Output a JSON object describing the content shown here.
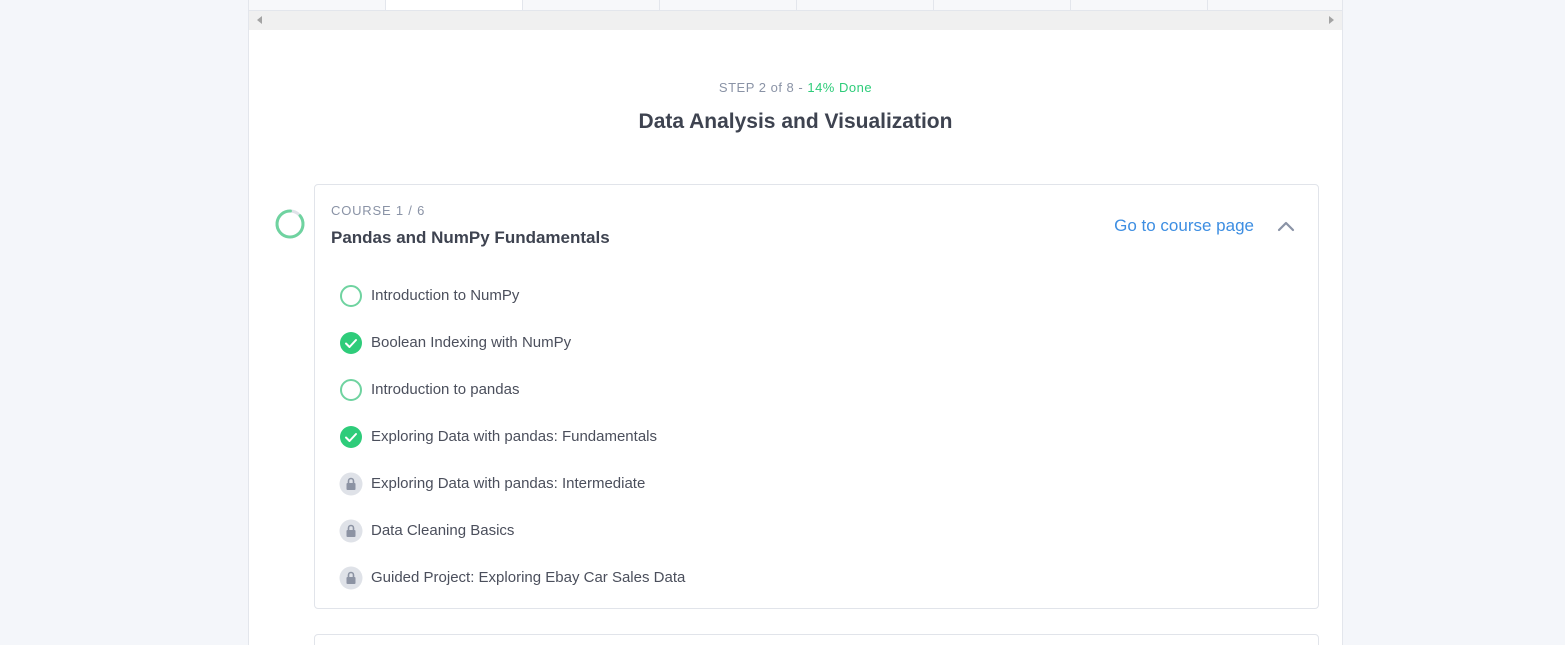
{
  "step": {
    "prefix": "STEP 2 of 8 - ",
    "done": "14% Done"
  },
  "path_title": "Data Analysis and Visualization",
  "course": {
    "label": "COURSE 1 / 6",
    "title": "Pandas and NumPy Fundamentals",
    "link_label": "Go to course page",
    "progress": 0.14,
    "lessons": [
      {
        "label": "Introduction to NumPy",
        "status": "in-progress"
      },
      {
        "label": "Boolean Indexing with NumPy",
        "status": "completed"
      },
      {
        "label": "Introduction to pandas",
        "status": "in-progress"
      },
      {
        "label": "Exploring Data with pandas: Fundamentals",
        "status": "completed"
      },
      {
        "label": "Exploring Data with pandas: Intermediate",
        "status": "locked"
      },
      {
        "label": "Data Cleaning Basics",
        "status": "locked"
      },
      {
        "label": "Guided Project: Exploring Ebay Car Sales Data",
        "status": "locked"
      }
    ]
  },
  "colors": {
    "accent_green": "#2ecc7a",
    "link_blue": "#3d8ee2",
    "locked_gray": "#dfe2e8"
  },
  "icons": {
    "in_progress": "progress-ring-icon",
    "completed": "check-circle-icon",
    "locked": "lock-icon",
    "collapse": "chevron-up-icon"
  }
}
